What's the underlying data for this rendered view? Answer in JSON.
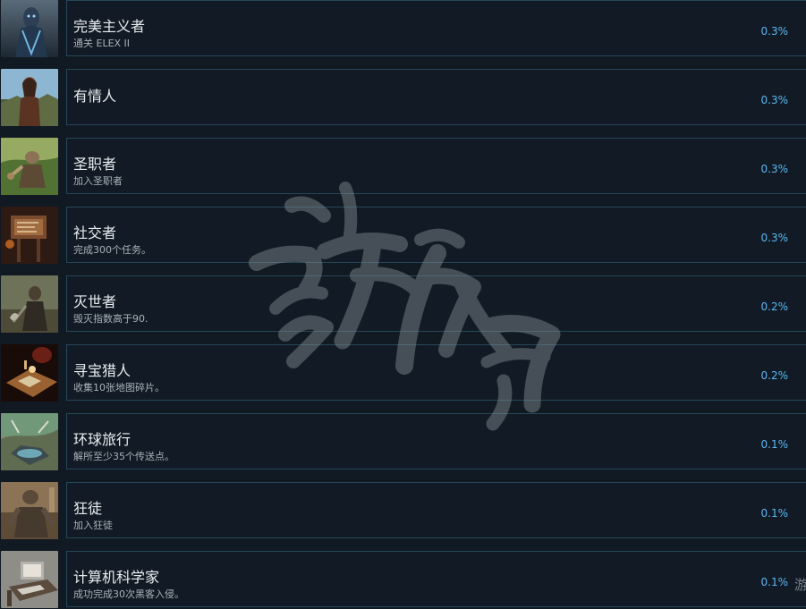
{
  "achievements": [
    {
      "icon": "dark-armored-creature-icon",
      "title": "完美主义者",
      "description": "通关 ELEX II",
      "percent": "0.3%"
    },
    {
      "icon": "wilderness-woman-portrait-icon",
      "title": "有情人",
      "description": "",
      "percent": "0.3%"
    },
    {
      "icon": "armored-warrior-field-icon",
      "title": "圣职者",
      "description": "加入圣职者",
      "percent": "0.3%"
    },
    {
      "icon": "wooden-notice-board-icon",
      "title": "社交者",
      "description": "完成300个任务。",
      "percent": "0.3%"
    },
    {
      "icon": "axe-warrior-forest-icon",
      "title": "灭世者",
      "description": "毁灭指数高于90.",
      "percent": "0.2%"
    },
    {
      "icon": "treasure-map-table-icon",
      "title": "寻宝猎人",
      "description": "收集10张地图碎片。",
      "percent": "0.2%"
    },
    {
      "icon": "teleporter-landscape-icon",
      "title": "环球旅行",
      "description": "解所至少35个传送点。",
      "percent": "0.1%"
    },
    {
      "icon": "mutant-brute-icon",
      "title": "狂徒",
      "description": "加入狂徒",
      "percent": "0.1%"
    },
    {
      "icon": "computer-desk-icon",
      "title": "计算机科学家",
      "description": "成功完成30次黑客入侵。",
      "percent": "0.1%"
    }
  ],
  "watermark": {
    "icon": "calligraphy-watermark-logo",
    "text": "游侠网"
  },
  "edge_glyph": "游",
  "colors": {
    "background": "#111923",
    "panel_border": "#24485a",
    "title": "#e8ecef",
    "description": "#a9b1b8",
    "percent": "#59b7f2"
  }
}
